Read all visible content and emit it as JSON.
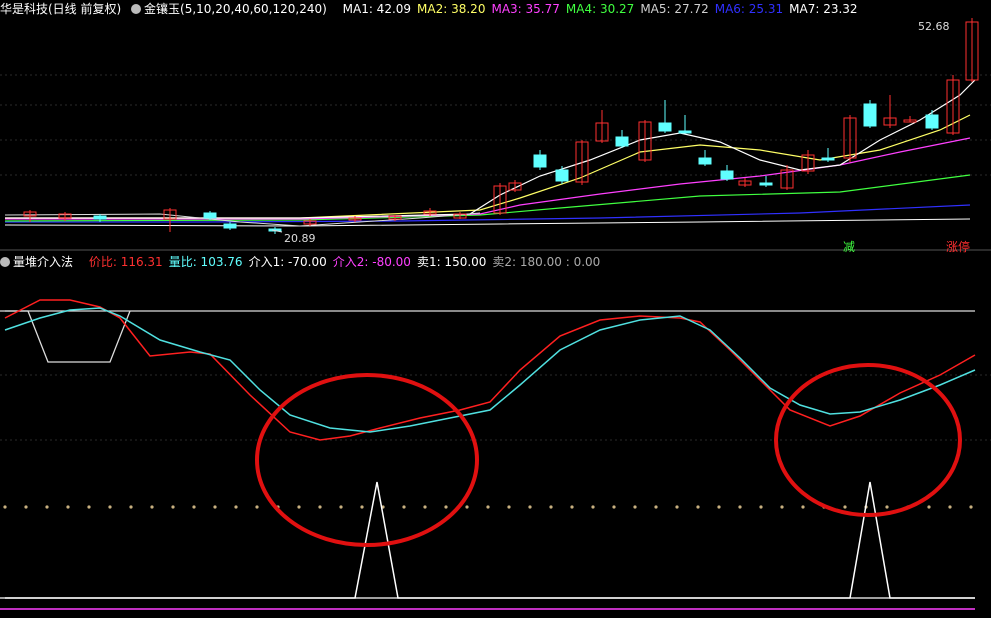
{
  "top_header": {
    "title": "华是科技(日线 前复权)",
    "indicator_name": "金镶玉(5,10,20,40,60,120,240)",
    "ma_items": [
      {
        "label": "MA1: 42.09",
        "color": "#ffffff"
      },
      {
        "label": "MA2: 38.20",
        "color": "#ffff66"
      },
      {
        "label": "MA3: 35.77",
        "color": "#ff40ff"
      },
      {
        "label": "MA4: 30.27",
        "color": "#40ff40"
      },
      {
        "label": "MA5: 27.72",
        "color": "#cfcfcf"
      },
      {
        "label": "MA6: 25.31",
        "color": "#3030ff"
      },
      {
        "label": "MA7: 23.32",
        "color": "#ffffff"
      }
    ]
  },
  "price_chart": {
    "high_label": "52.68",
    "low_label": "20.89",
    "signal_reduce": "减",
    "signal_limit_up": "涨停",
    "up_color": "#ff3030",
    "down_color": "#60ffff"
  },
  "indicator_header": {
    "name": "量堆介入法",
    "items": [
      {
        "label": "价比: 116.31",
        "color": "#ff3030"
      },
      {
        "label": "量比: 103.76",
        "color": "#60ffff"
      },
      {
        "label": "介入1: -70.00",
        "color": "#ffffff"
      },
      {
        "label": "介入2: -80.00",
        "color": "#ff40ff"
      },
      {
        "label": "卖1: 150.00",
        "color": "#ffffff"
      },
      {
        "label": "卖2: 180.00 : 0.00",
        "color": "#aaaaaa"
      }
    ]
  },
  "colors": {
    "price_ratio_line": "#ff2020",
    "volume_ratio_line": "#50e0e0",
    "signal_line": "#ffffff",
    "base_line": "#ff40ff",
    "dots": "#c8b080",
    "highlight_circle": "#e01010"
  }
}
